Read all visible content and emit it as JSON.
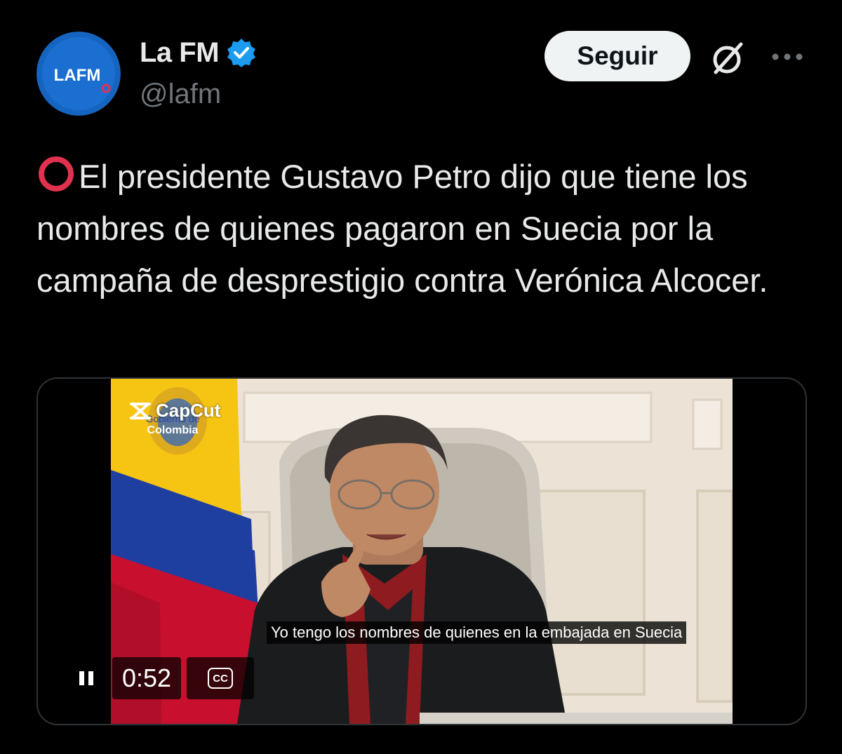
{
  "author": {
    "display_name": "La FM",
    "handle": "@lafm",
    "avatar_text": "LAFM",
    "verified": true,
    "verified_color": "#1d9bf0",
    "avatar_color": "#1565c0"
  },
  "header": {
    "follow_label": "Seguir",
    "grok_icon": "grok-icon",
    "more_icon": "more-options-icon"
  },
  "tweet": {
    "lead_emoji": "red-hollow-circle",
    "text": "El presidente Gustavo Petro dijo que tiene los nombres de quienes pagaron en Suecia por la campaña de desprestigio contra Verónica Alcocer."
  },
  "video": {
    "watermark": "CapCut",
    "emblem_line1": "Gobierno de",
    "emblem_line2": "Colombia",
    "caption": "Yo tengo los nombres de quienes en la embajada en Suecia",
    "time": "0:52",
    "cc_label": "CC",
    "state": "playing"
  },
  "colors": {
    "background": "#000000",
    "text_primary": "#e7e9ea",
    "text_secondary": "#71767b",
    "accent_red": "#e0314f"
  }
}
